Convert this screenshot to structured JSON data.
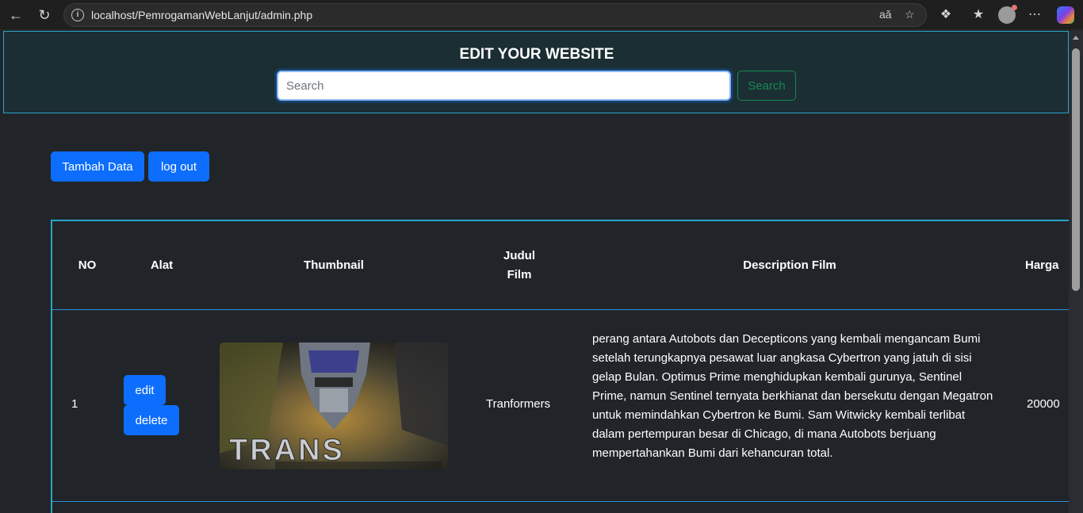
{
  "browser": {
    "url": "localhost/PemrogamanWebLanjut/admin.php"
  },
  "header": {
    "title": "EDIT YOUR WEBSITE",
    "search_placeholder": "Search",
    "search_button": "Search"
  },
  "actions": {
    "add_data": "Tambah Data",
    "logout": "log out"
  },
  "table": {
    "columns": [
      "NO",
      "Alat",
      "Thumbnail",
      "Judul Film",
      "Description Film",
      "Harga"
    ],
    "rows": [
      {
        "no": "1",
        "edit": "edit",
        "delete": "delete",
        "title": "Tranformers",
        "thumbnail_text": "TRANS",
        "description": "perang antara Autobots dan Decepticons yang kembali mengancam Bumi setelah terungkapnya pesawat luar angkasa Cybertron yang jatuh di sisi gelap Bulan. Optimus Prime menghidupkan kembali gurunya, Sentinel Prime, namun Sentinel ternyata berkhianat dan bersekutu dengan Megatron untuk memindahkan Cybertron ke Bumi. Sam Witwicky kembali terlibat dalam pertempuran besar di Chicago, di mana Autobots berjuang mempertahankan Bumi dari kehancuran total.",
        "price": "20000"
      }
    ]
  },
  "colors": {
    "primary": "#0d6efd",
    "success": "#198754",
    "accent_border": "#2aa5c9",
    "page_bg": "#212529"
  }
}
